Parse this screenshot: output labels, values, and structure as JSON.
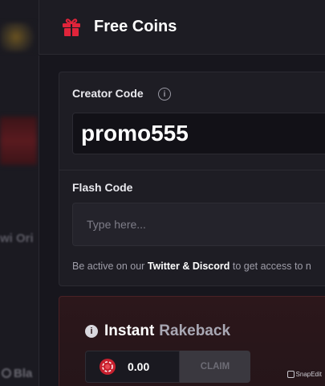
{
  "header": {
    "title": "Free Coins",
    "icon": "gift-icon",
    "accent_color": "#e0243a"
  },
  "background": {
    "partial_text_1": "wi Ori",
    "partial_text_2": "Bla"
  },
  "creator_code": {
    "label": "Creator Code",
    "value": "promo555"
  },
  "flash_code": {
    "label": "Flash Code",
    "placeholder": "Type here..."
  },
  "hint": {
    "prefix": "Be active on our ",
    "highlight": "Twitter & Discord",
    "suffix": " to get access to n"
  },
  "rakeback": {
    "title_bold": "Instant",
    "title_muted": "Rakeback",
    "amount": "0.00",
    "claim_label": "CLAIM"
  },
  "watermark": "SnapEdit"
}
